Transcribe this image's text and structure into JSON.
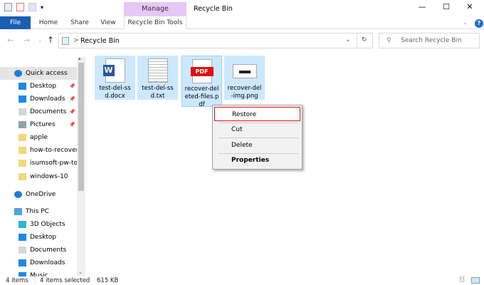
{
  "window": {
    "title": "Recycle Bin",
    "contextual_group": "Manage"
  },
  "ribbon": {
    "tabs": [
      "File",
      "Home",
      "Share",
      "View",
      "Recycle Bin Tools"
    ]
  },
  "address": {
    "path": "Recycle Bin",
    "separator": ">"
  },
  "search": {
    "placeholder": "Search Recycle Bin"
  },
  "nav": {
    "items": [
      {
        "label": "Quick access",
        "icon": "star-icon",
        "color": "#1e7fd8",
        "indent": 0,
        "selected": true
      },
      {
        "label": "Desktop",
        "icon": "desktop-icon",
        "color": "#1e88e5",
        "indent": 1,
        "pinned": true
      },
      {
        "label": "Downloads",
        "icon": "download-icon",
        "color": "#1e88e5",
        "indent": 1,
        "pinned": true
      },
      {
        "label": "Documents",
        "icon": "documents-icon",
        "color": "#cfd8dc",
        "indent": 1,
        "pinned": true
      },
      {
        "label": "Pictures",
        "icon": "pictures-icon",
        "color": "#90a4ae",
        "indent": 1,
        "pinned": true
      },
      {
        "label": "apple",
        "icon": "folder-check-icon",
        "color": "#f5d77a",
        "indent": 1
      },
      {
        "label": "how-to-recover-",
        "icon": "folder-alert-icon",
        "color": "#f5d77a",
        "indent": 1
      },
      {
        "label": "isumsoft-pw-toc",
        "icon": "folder-icon",
        "color": "#f5d77a",
        "indent": 1
      },
      {
        "label": "windows-10",
        "icon": "folder-alert-icon",
        "color": "#f5d77a",
        "indent": 1
      },
      {
        "label": "OneDrive",
        "icon": "cloud-icon",
        "color": "#1e7fd8",
        "indent": 0
      },
      {
        "label": "This PC",
        "icon": "computer-icon",
        "color": "#4fa3e0",
        "indent": 0
      },
      {
        "label": "3D Objects",
        "icon": "cube-icon",
        "color": "#29b6d8",
        "indent": 1
      },
      {
        "label": "Desktop",
        "icon": "desktop-icon",
        "color": "#1e88e5",
        "indent": 1
      },
      {
        "label": "Documents",
        "icon": "documents-icon",
        "color": "#cfd8dc",
        "indent": 1
      },
      {
        "label": "Downloads",
        "icon": "download-icon",
        "color": "#1e88e5",
        "indent": 1
      },
      {
        "label": "Music",
        "icon": "music-icon",
        "color": "#1e88e5",
        "indent": 1
      }
    ]
  },
  "files": [
    {
      "name": "test-del-ssd.docx",
      "lines": [
        "test-del-ss",
        "d.docx"
      ],
      "icon": "word-file-icon"
    },
    {
      "name": "test-del-ssd.txt",
      "lines": [
        "test-del-ss",
        "d.txt"
      ],
      "icon": "text-file-icon"
    },
    {
      "name": "recover-deleted-files.pdf",
      "lines": [
        "recover-del",
        "eted-files.p",
        "df"
      ],
      "icon": "pdf-file-icon",
      "badge": "PDF"
    },
    {
      "name": "recover-del-img.png",
      "lines": [
        "recover-del",
        "-img.png"
      ],
      "icon": "image-file-icon"
    }
  ],
  "context_menu": {
    "items": [
      "Restore",
      "Cut",
      "Delete",
      "Properties"
    ],
    "highlight_color": "#e81123"
  },
  "status": {
    "count": "4 items",
    "selected": "4 items selected",
    "size": "615 KB"
  },
  "colors": {
    "file_tab": "#1a5fb4",
    "manage": "#e7c8f5",
    "selection": "#cce8ff"
  }
}
